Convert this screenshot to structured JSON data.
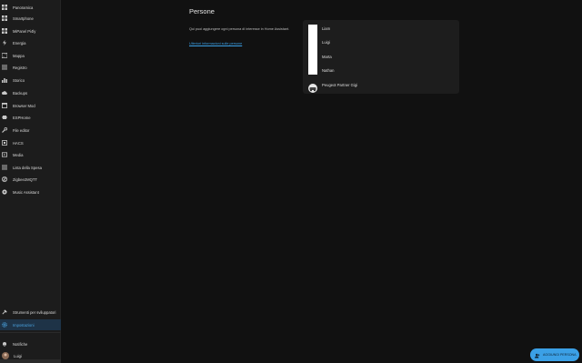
{
  "sidebar": {
    "items": [
      {
        "label": "Panoramica",
        "icon": "grid-icon"
      },
      {
        "label": "Smartphone",
        "icon": "grid-icon"
      },
      {
        "label": "MiPanel Pi4ly",
        "icon": "grid-icon"
      },
      {
        "label": "Energia",
        "icon": "bolt-icon"
      },
      {
        "label": "Mappa",
        "icon": "map-icon"
      },
      {
        "label": "Registro",
        "icon": "list-icon"
      },
      {
        "label": "Storico",
        "icon": "chart-icon"
      },
      {
        "label": "Backups",
        "icon": "cloud-icon"
      },
      {
        "label": "Browser Mod",
        "icon": "browser-icon"
      },
      {
        "label": "ESPHome",
        "icon": "chip-icon"
      },
      {
        "label": "File editor",
        "icon": "wrench-icon"
      },
      {
        "label": "HACS",
        "icon": "hacs-icon"
      },
      {
        "label": "Media",
        "icon": "media-icon"
      },
      {
        "label": "Lista della Spesa",
        "icon": "list-icon"
      },
      {
        "label": "Zigbee2MQTT",
        "icon": "zigbee-icon"
      },
      {
        "label": "Music Assistant",
        "icon": "music-icon"
      }
    ],
    "devtools_label": "Strumenti per sviluppatori",
    "settings_label": "Impostazioni",
    "notifications_label": "Notifiche",
    "user_label": "Luigi"
  },
  "main": {
    "title": "Persone",
    "description": "Qui puoi aggiungere ogni persona di interesse in Home Assistant.",
    "link": "Ulteriori informazioni sulle persone"
  },
  "people": [
    {
      "name": "Liam"
    },
    {
      "name": "Luigi"
    },
    {
      "name": "Marta"
    },
    {
      "name": "Nathan"
    },
    {
      "name": "Peugeot Partner Gigi"
    }
  ],
  "fab": {
    "label": "AGGIUNGI PERSONA"
  },
  "colors": {
    "accent": "#3ba0e6",
    "background": "#111111",
    "sidebar": "#1c1c1c",
    "card": "#1d1d1d"
  }
}
